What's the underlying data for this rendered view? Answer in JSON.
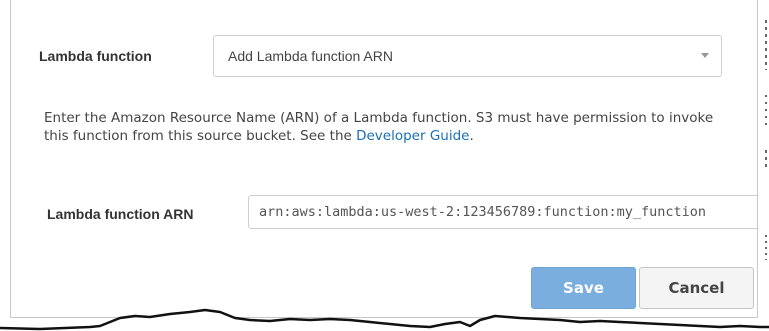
{
  "lambda_function": {
    "label": "Lambda function",
    "selected_value": "Add Lambda function ARN",
    "dropdown_icon": "chevron-down-icon"
  },
  "help_text": {
    "before_link": "Enter the Amazon Resource Name (ARN) of a Lambda function. S3 must have permission to invoke this function from this source bucket. See the ",
    "link_text": "Developer Guide",
    "after_link": "."
  },
  "lambda_arn": {
    "label": "Lambda function ARN",
    "value": "arn:aws:lambda:us-west-2:123456789:function:my_function"
  },
  "buttons": {
    "save_label": "Save",
    "cancel_label": "Cancel"
  },
  "colors": {
    "save_button": "#79aedf",
    "link": "#1a6fb5",
    "border": "#cfcfcf"
  }
}
